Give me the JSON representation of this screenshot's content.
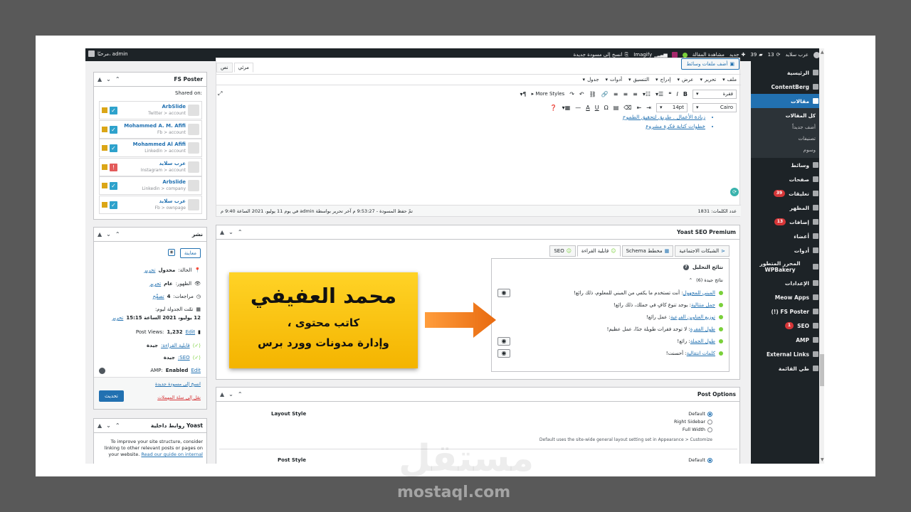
{
  "adminbar": {
    "site_name": "عرب سلايد",
    "updates_count": "13",
    "comments_count": "39",
    "new_label": "جديد",
    "view_post": "مشاهدة المقالة",
    "imagify": "Imagify",
    "copy_draft": "انسخ إلى مسودة جديدة",
    "greeting": "مرحبًا، admin"
  },
  "sidebar": {
    "items": [
      {
        "label": "الرئيسية",
        "icon": "dashboard-icon"
      },
      {
        "label": "ContentBerg",
        "icon": "pen-icon"
      },
      {
        "label": "مقالات",
        "icon": "pin-icon",
        "active": true
      },
      {
        "label": "وسائط",
        "icon": "media-icon"
      },
      {
        "label": "صفحات",
        "icon": "page-icon"
      },
      {
        "label": "تعليقات",
        "icon": "comment-icon",
        "badge": "39"
      },
      {
        "label": "المظهر",
        "icon": "brush-icon"
      },
      {
        "label": "إضافات",
        "icon": "plugin-icon",
        "badge": "13"
      },
      {
        "label": "أعضاء",
        "icon": "user-icon"
      },
      {
        "label": "أدوات",
        "icon": "wrench-icon"
      },
      {
        "label": "المحرر المتطور WPBakery",
        "icon": "bakery-icon"
      },
      {
        "label": "الإعدادات",
        "icon": "settings-icon"
      },
      {
        "label": "Meow Apps",
        "icon": "meow-icon"
      },
      {
        "label": "FS Poster (!)",
        "icon": "fs-icon"
      },
      {
        "label": "SEO",
        "icon": "yoast-icon",
        "badge": "1"
      },
      {
        "label": "AMP",
        "icon": "amp-icon"
      },
      {
        "label": "External Links",
        "icon": "link-icon"
      },
      {
        "label": "طي القائمة",
        "icon": "collapse-icon"
      }
    ],
    "subitems": [
      "كل المقالات",
      "أضف جديداً",
      "تصنيفات",
      "وسوم"
    ]
  },
  "editor": {
    "add_media": "أضف ملفات وسائط",
    "tab_visual": "مرئي",
    "tab_text": "نص",
    "menu": [
      "ملف",
      "تحرير",
      "عرض",
      "إدراج",
      "التنسيق",
      "أدوات",
      "جدول"
    ],
    "format": "فقرة",
    "font": "Cairo",
    "size": "14pt",
    "more_styles": "More Styles",
    "list": [
      "زيادة الأعمال . طريق لتحقيق الطموح",
      "خطوات كتابة فكرة مشروع"
    ],
    "word_count": "عدد الكلمات: 1831",
    "draft_saved": "تمّ حفظ المسودة - 9:53:27 م آخر تحرير بواسطة admin في يوم 11 يوليو، 2021 الساعة 9:40 م"
  },
  "fs_poster": {
    "title": "FS Poster",
    "shared_on": "Shared on:",
    "accounts": [
      {
        "name": "ArbSlide",
        "sub": "Twitter > account",
        "ok": true
      },
      {
        "name": "Mohammed A. M. Afifi",
        "sub": "Fb > account",
        "ok": true
      },
      {
        "name": "Mohammed Al Afifi",
        "sub": "Linkedin > account",
        "ok": true
      },
      {
        "name": "عرب سلايد",
        "sub": "Instagram > account",
        "ok": false
      },
      {
        "name": "Arbslide",
        "sub": "Linkedin > company",
        "ok": true
      },
      {
        "name": "عرب سلايد",
        "sub": "Fb > ownpage",
        "ok": true
      }
    ]
  },
  "publish": {
    "title": "نشر",
    "preview": "معاينة",
    "status_label": "الحالة:",
    "status_value": "محدول",
    "edit": "تحرير",
    "visibility_label": "الظهور:",
    "visibility_value": "عام",
    "revisions_label": "مراجعات:",
    "revisions_value": "4",
    "revisions_link": "تصفّح",
    "scheduled_label": "تمّت الجدولة ليوم:",
    "scheduled_value": "12 يوليو، 2021 الساعة 15:15",
    "views_label": "Post Views:",
    "views_value": "1,232",
    "views_edit": "Edit",
    "readability_label": "قابلية القراءة:",
    "readability_value": "جيدة",
    "seo_label": "SEO:",
    "seo_value": "جيدة",
    "amp_label": "AMP:",
    "amp_value": "Enabled",
    "amp_edit": "Edit",
    "copy_link": "انسخ إلى مسودة جديدة",
    "trash_link": "نقل إلى سلة المهملات",
    "update_button": "تحديث"
  },
  "yoast_links": {
    "title": "روابط داخلية Yoast",
    "text": "To improve your site structure, consider linking to other relevant posts or pages on your website.",
    "guide": "Read our guide on internal"
  },
  "yoast": {
    "title": "Yoast SEO Premium",
    "tabs": [
      "SEO",
      "قابلية القراءة",
      "مخطط Schema",
      "الشبكات الاجتماعية"
    ],
    "results_title": "نتائج التحليل",
    "good_results": "نتائج جيدة (6)",
    "items": [
      {
        "link": "المبني للمجهول",
        "text": ": أنت تستخدم ما يكفي من المبني للمعلوم، ذلك رائع!",
        "eye": true
      },
      {
        "link": "جمل متتالية",
        "text": ": يوجد تنوع كافٍ في جملك، ذلك رائع!",
        "eye": false
      },
      {
        "link": "توزيع العناوين الفرعية",
        "text": ": عمل رائع!",
        "eye": false
      },
      {
        "link": "طول الفقرة",
        "text": ": لا توجد فقرات طويلة جدًا، عمل عظيم!",
        "eye": false
      },
      {
        "link": "طول الجملة",
        "text": ": رائع!",
        "eye": true
      },
      {
        "link": "كلمات انتقالية",
        "text": ": أحسنت!",
        "eye": true
      }
    ]
  },
  "post_options": {
    "title": "Post Options",
    "layout_label": "Layout Style",
    "layout_options": [
      "Default",
      "Right Sidebar",
      "Full Width"
    ],
    "layout_help": "Default uses the site-wide general layout setting set in Appearance > Customize",
    "post_style_label": "Post Style",
    "post_style_value": "Default"
  },
  "promo": {
    "name": "محمد العفيفي",
    "line1": "كاتب محتوى ،",
    "line2": "وإدارة مدونات وورد برس"
  },
  "watermark": {
    "arabic": "مستقل",
    "latin": "mostaql.com"
  },
  "colors": {
    "accent": "#2271b1",
    "adminbar": "#1d2327",
    "promo_bg": "#ffd326",
    "arrow": "#f07820",
    "good": "#7ad03a"
  }
}
